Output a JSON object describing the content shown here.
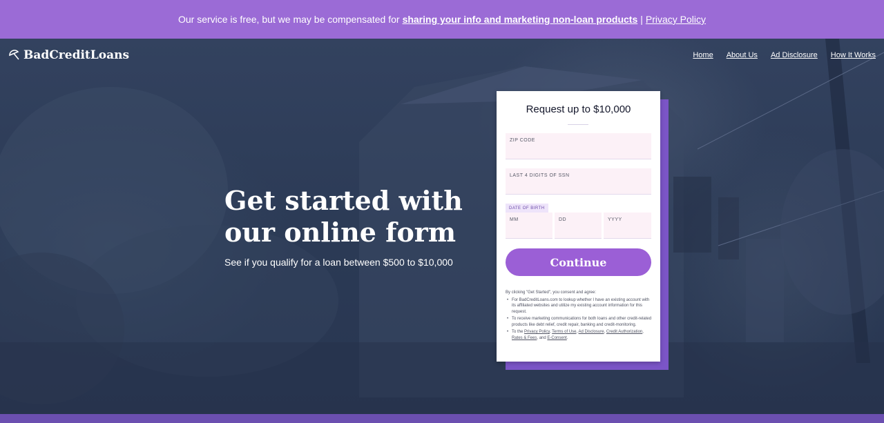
{
  "banner": {
    "text_before": "Our service is free, but we may be compensated for",
    "marketing_link": "sharing your info and marketing non-loan products",
    "separator": "|",
    "privacy_link": "Privacy Policy"
  },
  "brand": {
    "name": "BadCreditLoans",
    "icon": "umbrella-icon"
  },
  "nav": {
    "items": [
      "Home",
      "About Us",
      "Ad Disclosure",
      "How It Works"
    ]
  },
  "hero": {
    "title": "Get started with our online form",
    "subtitle": "See if you qualify for a loan between $500 to $10,000"
  },
  "form": {
    "title": "Request up to $10,000",
    "zip_label": "ZIP CODE",
    "ssn_label": "LAST 4 DIGITS OF SSN",
    "dob_label": "DATE OF BIRTH",
    "mm_label": "MM",
    "dd_label": "DD",
    "yyyy_label": "YYYY",
    "continue_label": "Continue"
  },
  "consent": {
    "intro": "By clicking \"Get Started\", you consent and agree:",
    "item1": "For BadCreditLoans.com to lookup whether I have an existing account with its affiliated websites and utilize my existing account information for this request.",
    "item2": "To receive marketing communications for both loans and other credit-related products like debt relief, credit repair, banking and credit-monitoring.",
    "item3_prefix": "To the",
    "links": {
      "privacy": "Privacy Policy",
      "terms": "Terms of Use",
      "ad_disclosure": "Ad Disclosure",
      "credit_authorization": "Credit Authorization",
      "rates_fees": "Rates & Fees",
      "e_consent": "E-Consent"
    },
    "comma": ",",
    "and": "and",
    "period": "."
  },
  "colors": {
    "banner": "#9b6bd6",
    "accent": "#9b5fd6",
    "card_shadow": "#7b55c7",
    "hero_overlay": "#2c3a55",
    "field_bg": "#fcf1f7"
  }
}
